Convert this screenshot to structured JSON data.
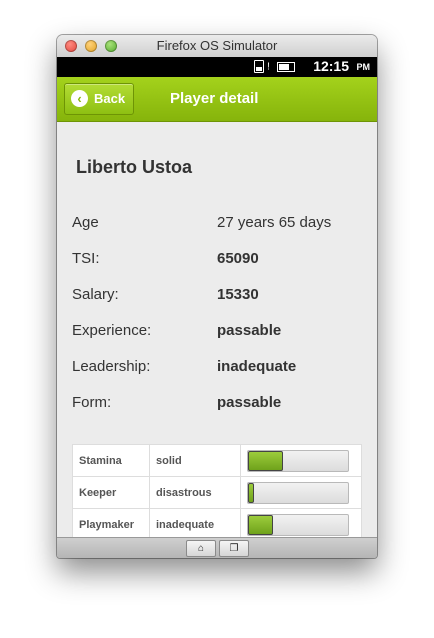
{
  "window": {
    "title": "Firefox OS Simulator"
  },
  "statusbar": {
    "time": "12:15",
    "ampm": "PM",
    "sim_icon": "sim-card-icon",
    "battery_icon": "battery-icon"
  },
  "header": {
    "back_label": "Back",
    "back_icon": "chevron-left-icon",
    "title": "Player detail"
  },
  "player": {
    "name": "Liberto Ustoa",
    "info": [
      {
        "label": "Age",
        "value": "27 years 65 days",
        "bold": false
      },
      {
        "label": "TSI:",
        "value": "65090",
        "bold": true
      },
      {
        "label": "Salary:",
        "value": "15330",
        "bold": true
      },
      {
        "label": "Experience:",
        "value": "passable",
        "bold": true
      },
      {
        "label": "Leadership:",
        "value": "inadequate",
        "bold": true
      },
      {
        "label": "Form:",
        "value": "passable",
        "bold": true
      }
    ],
    "skills": [
      {
        "name": "Stamina",
        "level": "solid",
        "fill_fraction": 0.35
      },
      {
        "name": "Keeper",
        "level": "disastrous",
        "fill_fraction": 0.06
      },
      {
        "name": "Playmaker",
        "level": "inadequate",
        "fill_fraction": 0.25
      }
    ]
  },
  "bottombar": {
    "home_icon": "home-icon",
    "windows_icon": "windows-icon"
  },
  "colors": {
    "accent": "#96c417",
    "bar_fill": "#86b82c"
  }
}
